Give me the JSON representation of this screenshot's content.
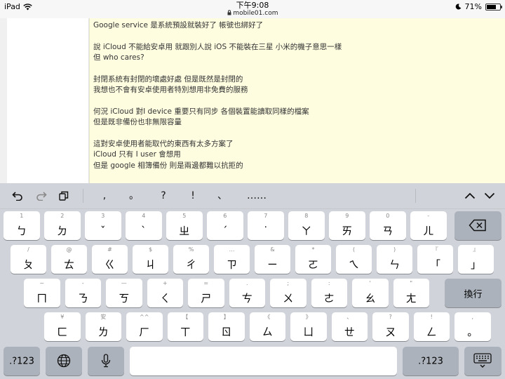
{
  "status": {
    "device": "iPad",
    "time": "下午9:08",
    "url": "mobile01.com",
    "battery": "71%",
    "battery_level": 0.71
  },
  "post": {
    "paragraphs": [
      [
        "Google service 是系統預設就裝好了 帳號也綁好了"
      ],
      [
        "說 iCloud 不能給安卓用 就跟別人說 iOS 不能裝在三星 小米的機子意思一樣",
        "但 who cares?"
      ],
      [
        "封閉系統有封閉的壞處好處 但是既然是封閉的",
        "我想也不會有安卓使用者特別想用非免費的服務"
      ],
      [
        "何況 iCloud 對I device 重要只有同步 各個裝置能讀取同樣的檔案",
        "但是既非備份也非無限容量"
      ],
      [
        "這對安卓使用者能取代的東西有太多方案了",
        "iCloud 只有 I user 會想用",
        "但是 google 相簿備份 則是兩邊都難以抗拒的"
      ]
    ]
  },
  "suggestions": [
    ",",
    "。",
    "?",
    "!",
    "、",
    "……"
  ],
  "keyboard": {
    "row1": [
      {
        "sec": "1",
        "pri": "ㄅ"
      },
      {
        "sec": "2",
        "pri": "ㄉ"
      },
      {
        "sec": "3",
        "pri": "ˇ"
      },
      {
        "sec": "4",
        "pri": "ˋ"
      },
      {
        "sec": "5",
        "pri": "ㄓ"
      },
      {
        "sec": "6",
        "pri": "ˊ"
      },
      {
        "sec": "7",
        "pri": "˙"
      },
      {
        "sec": "8",
        "pri": "ㄚ"
      },
      {
        "sec": "9",
        "pri": "ㄞ"
      },
      {
        "sec": "0",
        "pri": "ㄢ"
      },
      {
        "sec": "-",
        "pri": "ㄦ"
      }
    ],
    "row2": [
      {
        "sec": "/",
        "pri": "ㄆ"
      },
      {
        "sec": "@",
        "pri": "ㄊ"
      },
      {
        "sec": "#",
        "pri": "ㄍ"
      },
      {
        "sec": "$",
        "pri": "ㄐ"
      },
      {
        "sec": "%",
        "pri": "ㄔ"
      },
      {
        "sec": "…",
        "pri": "ㄗ"
      },
      {
        "sec": "&",
        "pri": "ㄧ"
      },
      {
        "sec": "*",
        "pri": "ㄛ"
      },
      {
        "sec": "(",
        "pri": "ㄟ"
      },
      {
        "sec": ")",
        "pri": "ㄣ"
      },
      {
        "sec": "『",
        "pri": "「"
      },
      {
        "sec": "』",
        "pri": "」"
      }
    ],
    "row3": [
      {
        "sec": "~",
        "pri": "ㄇ"
      },
      {
        "sec": "-",
        "pri": "ㄋ"
      },
      {
        "sec": "—",
        "pri": "ㄎ"
      },
      {
        "sec": "+",
        "pri": "ㄑ"
      },
      {
        "sec": "=",
        "pri": "ㄕ"
      },
      {
        "sec": ".",
        "pri": "ㄘ"
      },
      {
        "sec": ";",
        "pri": "ㄨ"
      },
      {
        "sec": ":",
        "pri": "ㄜ"
      },
      {
        "sec": "'",
        "pri": "ㄠ"
      },
      {
        "sec": "\"",
        "pri": "ㄤ"
      }
    ],
    "row4": [
      {
        "sec": "¥",
        "pri": "ㄈ"
      },
      {
        "sec": "安",
        "pri": "ㄌ"
      },
      {
        "sec": "^^",
        "pri": "ㄏ"
      },
      {
        "sec": "【",
        "pri": "ㄒ"
      },
      {
        "sec": "】",
        "pri": "ㄖ"
      },
      {
        "sec": "《",
        "pri": "ㄙ"
      },
      {
        "sec": "》",
        "pri": "ㄩ"
      },
      {
        "sec": "、",
        "pri": "ㄝ"
      },
      {
        "sec": "?",
        "pri": "ㄡ"
      },
      {
        "sec": "!",
        "pri": "ㄥ"
      },
      {
        "sec": ",",
        "pri": "。"
      }
    ],
    "enter_label": "換行",
    "numbers_label": ".?123"
  }
}
